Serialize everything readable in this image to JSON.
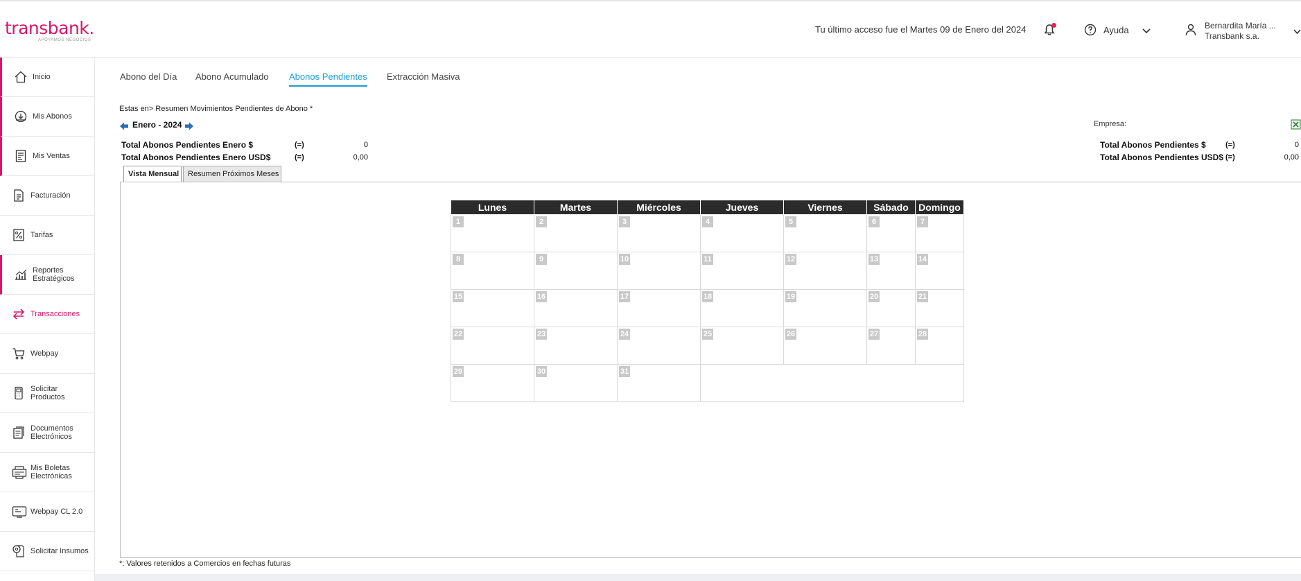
{
  "brand": {
    "name": "transbank",
    "dot": ".",
    "tagline": "APOYAMOS NEGOCIOS",
    "color": "#d6176b"
  },
  "header": {
    "last_access": "Tu último acceso fue el Martes 09 de Enero del 2024",
    "help_label": "Ayuda",
    "user_name": "Bernardita María ...",
    "user_company": "Transbank s.a."
  },
  "sidebar": {
    "items": [
      {
        "label": "Inicio",
        "icon": "home-icon"
      },
      {
        "label": "Mis Abonos",
        "icon": "deposit-icon"
      },
      {
        "label": "Mis Ventas",
        "icon": "sales-icon"
      },
      {
        "label": "Facturación",
        "icon": "invoice-icon"
      },
      {
        "label": "Tarifas",
        "icon": "percent-icon"
      },
      {
        "label": "Reportes Estratégicos",
        "icon": "chart-icon"
      },
      {
        "label": "Transacciones",
        "icon": "transfer-icon"
      },
      {
        "label": "Webpay",
        "icon": "cart-icon"
      },
      {
        "label": "Solicitar Productos",
        "icon": "pos-terminal-icon"
      },
      {
        "label": "Documentos Electrónicos",
        "icon": "documents-icon"
      },
      {
        "label": "Mis Boletas Electrónicas",
        "icon": "receipts-icon"
      },
      {
        "label": "Webpay CL 2.0",
        "icon": "webpay-terminal-icon"
      },
      {
        "label": "Solicitar Insumos",
        "icon": "paper-roll-icon"
      }
    ]
  },
  "tabs": [
    "Abono del Día",
    "Abono Acumulado",
    "Abonos Pendientes",
    "Extracción Masiva"
  ],
  "active_tab": "Abonos Pendientes",
  "breadcrumb": {
    "prefix": "Estas en>",
    "current": "Resumen Movimientos Pendientes de Abono *"
  },
  "month_label": "Enero - 2024",
  "totals_left": [
    {
      "label": "Total Abonos Pendientes Enero $",
      "sign": "(=)",
      "value": "0"
    },
    {
      "label": "Total Abonos Pendientes Enero USD$",
      "sign": "(=)",
      "value": "0,00"
    }
  ],
  "empresa_label": "Empresa:",
  "totals_right": [
    {
      "label": "Total Abonos Pendientes $",
      "sign": "(=)",
      "value": "0"
    },
    {
      "label": "Total Abonos Pendientes USD$",
      "sign": "(=)",
      "value": "0,00"
    }
  ],
  "sub_tabs": [
    "Vista Mensual",
    "Resumen Próximos Meses"
  ],
  "calendar": {
    "weekdays": [
      "Lunes",
      "Martes",
      "Miércoles",
      "Jueves",
      "Viernes",
      "Sábado",
      "Domingo"
    ],
    "weeks": [
      [
        "1",
        "2",
        "3",
        "4",
        "5",
        "6",
        "7"
      ],
      [
        "8",
        "9",
        "10",
        "11",
        "12",
        "13",
        "14"
      ],
      [
        "15",
        "16",
        "17",
        "18",
        "19",
        "20",
        "21"
      ],
      [
        "22",
        "23",
        "24",
        "25",
        "26",
        "27",
        "28"
      ],
      [
        "29",
        "30",
        "31"
      ]
    ]
  },
  "footnote": "*: Valores retenidos a Comercios en fechas futuras"
}
